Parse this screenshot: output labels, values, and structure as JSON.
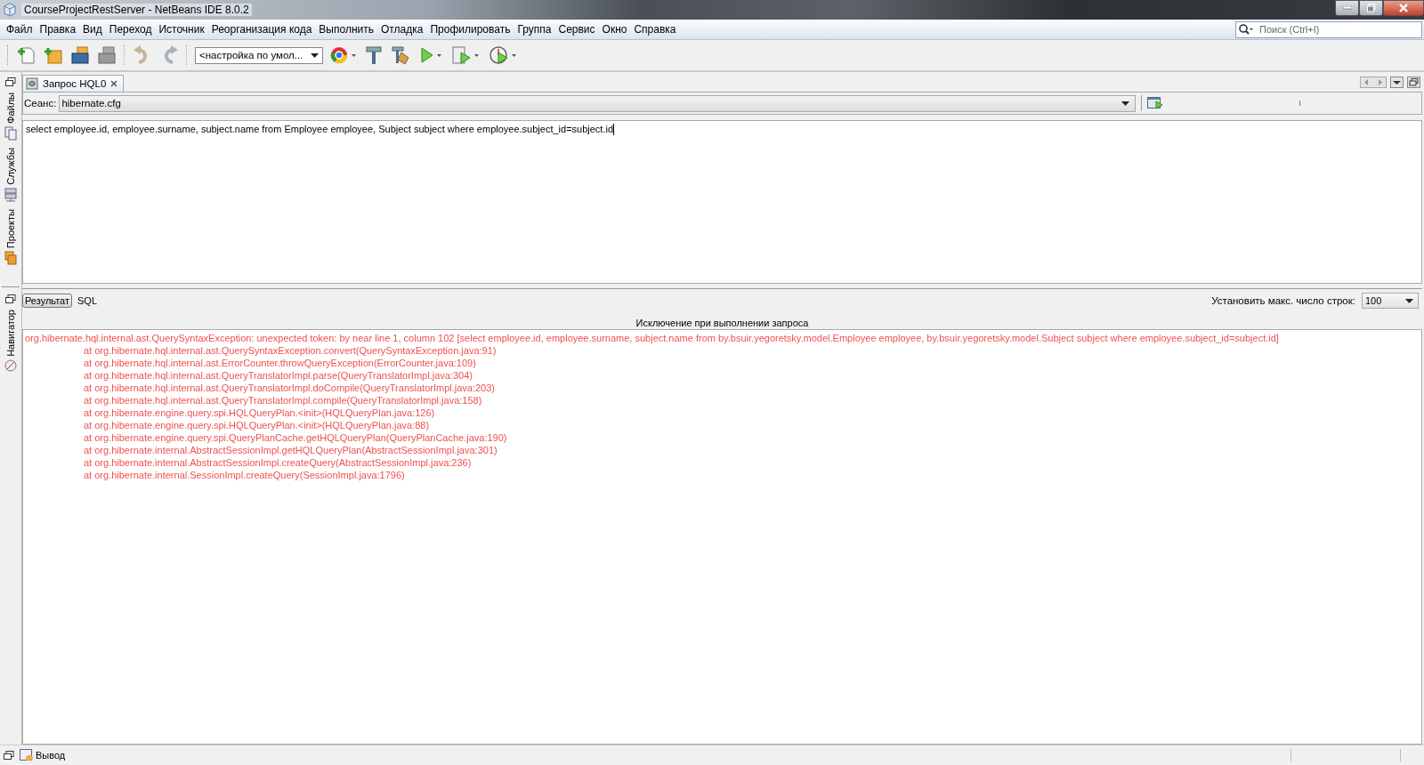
{
  "window": {
    "title": "CourseProjectRestServer - NetBeans IDE 8.0.2"
  },
  "menu": [
    "Файл",
    "Правка",
    "Вид",
    "Переход",
    "Источник",
    "Реорганизация кода",
    "Выполнить",
    "Отладка",
    "Профилировать",
    "Группа",
    "Сервис",
    "Окно",
    "Справка"
  ],
  "search": {
    "placeholder": "Поиск (Ctrl+I)"
  },
  "toolbar": {
    "configuration": "<настройка по умол..."
  },
  "side_tabs_top": [
    "Файлы",
    "Службы",
    "Проекты"
  ],
  "side_tabs_bottom": [
    "Навигатор"
  ],
  "editor_tab": {
    "label": "Запрос HQL0"
  },
  "session": {
    "label": "Сеанс:",
    "value": "hibernate.cfg"
  },
  "query": "select employee.id, employee.surname, subject.name from Employee employee, Subject subject where employee.subject_id=subject.id",
  "result_tabs": [
    {
      "label": "Результат",
      "selected": true
    },
    {
      "label": "SQL",
      "selected": false
    }
  ],
  "max_rows": {
    "label": "Установить макс. число строк:",
    "value": "100"
  },
  "result_header": "Исключение при выполнении запроса",
  "error_lines": [
    {
      "kind": "exception",
      "text": "org.hibernate.hql.internal.ast.QuerySyntaxException: unexpected token: by near line 1, column 102 [select employee.id, employee.surname, subject.name from by.bsuir.yegoretsky.model.Employee employee, by.bsuir.yegoretsky.model.Subject subject where employee.subject_id=subject.id]"
    },
    {
      "kind": "frame",
      "text": "at org.hibernate.hql.internal.ast.QuerySyntaxException.convert(QuerySyntaxException.java:91)"
    },
    {
      "kind": "frame",
      "text": "at org.hibernate.hql.internal.ast.ErrorCounter.throwQueryException(ErrorCounter.java:109)"
    },
    {
      "kind": "frame",
      "text": "at org.hibernate.hql.internal.ast.QueryTranslatorImpl.parse(QueryTranslatorImpl.java:304)"
    },
    {
      "kind": "frame",
      "text": "at org.hibernate.hql.internal.ast.QueryTranslatorImpl.doCompile(QueryTranslatorImpl.java:203)"
    },
    {
      "kind": "frame",
      "text": "at org.hibernate.hql.internal.ast.QueryTranslatorImpl.compile(QueryTranslatorImpl.java:158)"
    },
    {
      "kind": "frame",
      "text": "at org.hibernate.engine.query.spi.HQLQueryPlan.<init>(HQLQueryPlan.java:126)"
    },
    {
      "kind": "frame",
      "text": "at org.hibernate.engine.query.spi.HQLQueryPlan.<init>(HQLQueryPlan.java:88)"
    },
    {
      "kind": "frame",
      "text": "at org.hibernate.engine.query.spi.QueryPlanCache.getHQLQueryPlan(QueryPlanCache.java:190)"
    },
    {
      "kind": "frame",
      "text": "at org.hibernate.internal.AbstractSessionImpl.getHQLQueryPlan(AbstractSessionImpl.java:301)"
    },
    {
      "kind": "frame",
      "text": "at org.hibernate.internal.AbstractSessionImpl.createQuery(AbstractSessionImpl.java:236)"
    },
    {
      "kind": "frame",
      "text": "at org.hibernate.internal.SessionImpl.createQuery(SessionImpl.java:1796)"
    }
  ],
  "status_bar": {
    "output_tab": "Вывод"
  }
}
